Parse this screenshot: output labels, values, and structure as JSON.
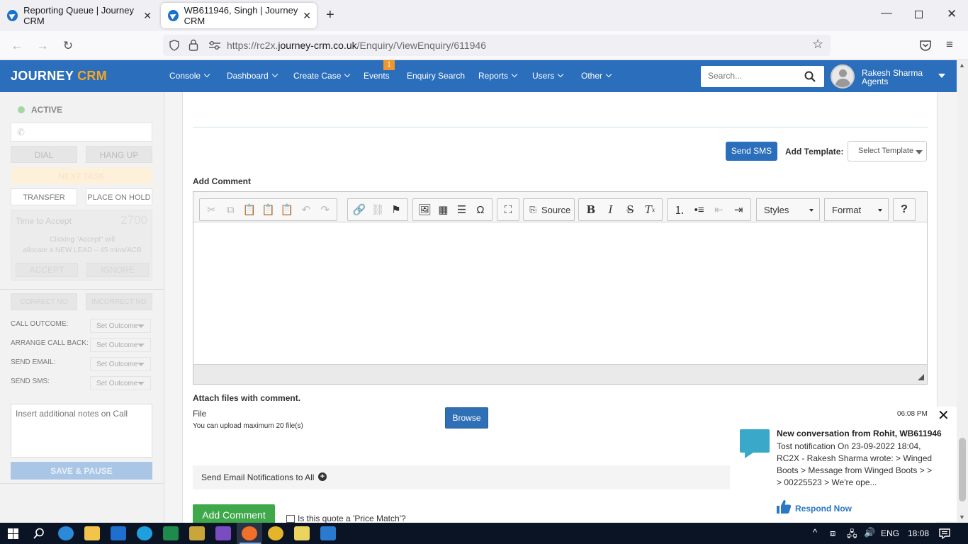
{
  "browser": {
    "tabs": [
      {
        "title": "Reporting Queue | Journey CRM"
      },
      {
        "title": "WB611946, Singh | Journey CRM"
      }
    ],
    "url_prefix": "https://rc2x.",
    "url_domain": "journey-crm.co.uk",
    "url_path": "/Enquiry/ViewEnquiry/611946"
  },
  "app": {
    "logo_journey": "JOURNEY",
    "logo_crm": "CRM",
    "brand_color": "#2a6ebc",
    "menu": [
      {
        "label": "Console",
        "has_chevron": true
      },
      {
        "label": "Dashboard",
        "has_chevron": true
      },
      {
        "label": "Create Case",
        "has_chevron": true
      },
      {
        "label": "Events",
        "has_chevron": false
      },
      {
        "label": "Enquiry Search",
        "has_chevron": false
      },
      {
        "label": "Reports",
        "has_chevron": true
      },
      {
        "label": "Users",
        "has_chevron": true
      },
      {
        "label": "Other",
        "has_chevron": true
      }
    ],
    "events_badge": "1",
    "search_placeholder": "Search...",
    "user_name": "Rakesh Sharma",
    "user_role": "Agents"
  },
  "left_panel": {
    "status": "ACTIVE",
    "dial": "DIAL",
    "hang_up": "HANG UP",
    "next_task": "NEXT TASK",
    "transfer": "TRANSFER",
    "place_on_hold": "PLACE ON HOLD",
    "time_to_accept_label": "Time to Accept",
    "time_to_accept_value": "2700",
    "accept_hint_1": "Clicking \"Accept\" will",
    "accept_hint_2": "allocate a NEW LEAD – 45 mins/ACB",
    "accept": "ACCEPT",
    "ignore": "IGNORE",
    "correct_no": "CORRECT NO",
    "incorrect_no": "INCORRECT NO",
    "outcomes": [
      {
        "label": "CALL OUTCOME:",
        "value": "Set Outcome"
      },
      {
        "label": "ARRANGE CALL BACK:",
        "value": "Set Outcome"
      },
      {
        "label": "SEND EMAIL:",
        "value": "Set Outcome"
      },
      {
        "label": "SEND SMS:",
        "value": "Set Outcome"
      }
    ],
    "notes_placeholder": "Insert additional notes on Call",
    "save_pause": "SAVE & PAUSE"
  },
  "main": {
    "send_sms": "Send SMS",
    "add_template_label": "Add Template:",
    "select_template": "Select Template",
    "add_comment_label": "Add Comment",
    "toolbar_source": "Source",
    "toolbar_styles": "Styles",
    "toolbar_format": "Format",
    "toolbar_help": "?",
    "attach_label": "Attach files with comment.",
    "file_label": "File",
    "upload_hint": "You can upload maximum 20 file(s)",
    "browse": "Browse",
    "send_email_notifications": "Send Email Notifications to All",
    "add_comment_button": "Add Comment",
    "price_match_label": "Is this quote a 'Price Match'?"
  },
  "toast": {
    "time": "06:08 PM",
    "title": "New conversation from Rohit, WB611946",
    "body": "Tost notification On 23-09-2022 18:04, RC2X - Rakesh Sharma wrote: > Winged Boots > Message from Winged Boots > > > 00225523 > We're ope...",
    "action": "Respond Now"
  },
  "taskbar": {
    "language": "ENG",
    "clock": "18:08"
  }
}
